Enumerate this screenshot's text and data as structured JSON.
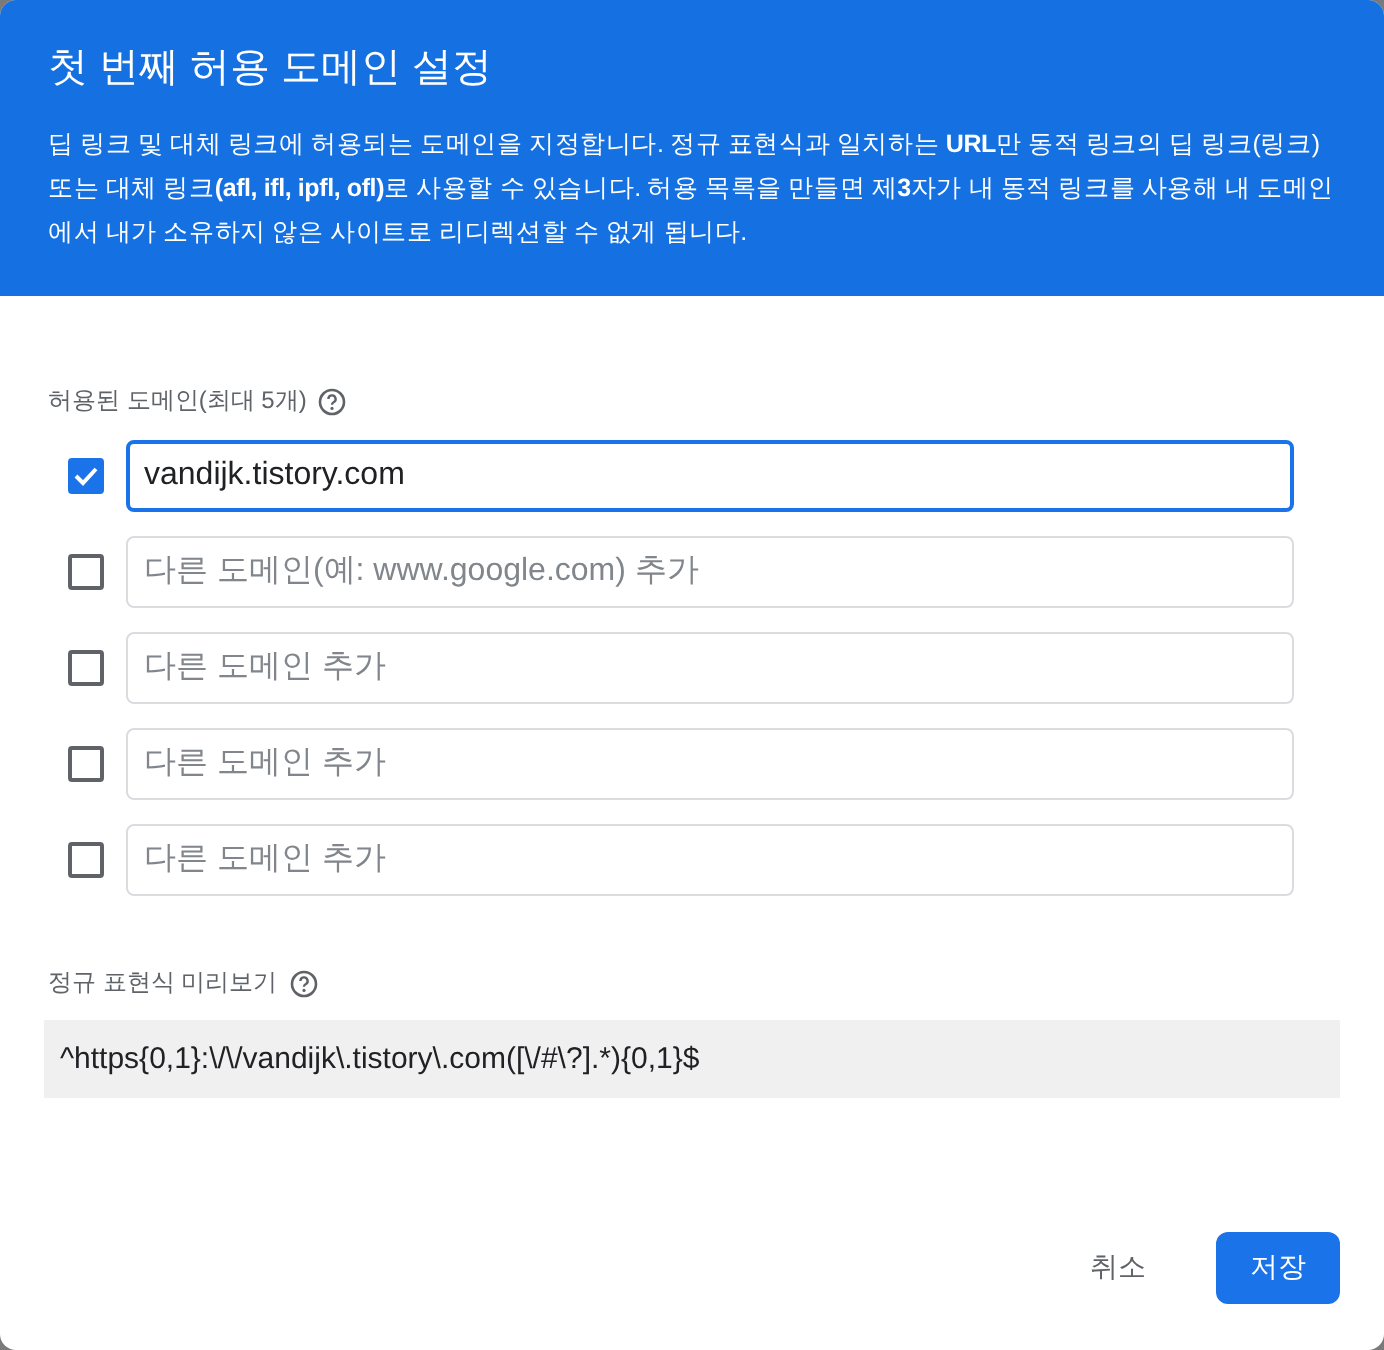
{
  "dialog": {
    "title": "첫 번째 허용 도메인 설정",
    "description": "딥 링크 및 대체 링크에 허용되는 도메인을 지정합니다. 정규 표현식과 일치하는 **URL**만 동적 링크의 딥 링크(링크) 또는 대체 링크**(afl, ifl, ipfl, ofl)**로 사용할 수 있습니다. 허용 목록을 만들면 제**3**자가 내 동적 링크를 사용해 내 도메인에서 내가 소유하지 않은 사이트로 리디렉션할 수 없게 됩니다."
  },
  "domains": {
    "label": "허용된 도메인(최대 5개)",
    "items": [
      {
        "checked": true,
        "focused": true,
        "value": "vandijk.tistory.com"
      },
      {
        "checked": false,
        "focused": false,
        "placeholder": "다른 도메인(예: www.google.com) 추가"
      },
      {
        "checked": false,
        "focused": false,
        "placeholder": "다른 도메인 추가"
      },
      {
        "checked": false,
        "focused": false,
        "placeholder": "다른 도메인 추가"
      },
      {
        "checked": false,
        "focused": false,
        "placeholder": "다른 도메인 추가"
      }
    ]
  },
  "regex_preview": {
    "label": "정규 표현식 미리보기",
    "value": "^https{0,1}:\\/\\/vandijk\\.tistory\\.com([\\/#\\?].*){0,1}$"
  },
  "buttons": [
    {
      "kind": "text",
      "label": "취소"
    },
    {
      "kind": "primary",
      "label": "저장"
    }
  ]
}
